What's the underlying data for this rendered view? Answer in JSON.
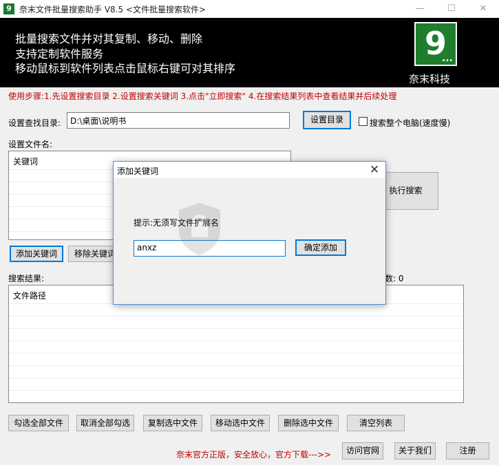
{
  "window": {
    "title": "奈末文件批量搜索助手 V8.5    <文件批量搜索软件>",
    "app_icon_glyph": "9",
    "minimize_glyph": "—",
    "maximize_glyph": "☐",
    "close_glyph": "✕"
  },
  "banner": {
    "lines": [
      "批量搜索文件并对其复制、移动、删除",
      "支持定制软件服务",
      "移动鼠标到软件列表点击鼠标右键可对其排序"
    ],
    "logo_digit": "9",
    "logo_dots": "...",
    "company": "奈末科技"
  },
  "steps_text": "使用步骤:1.先设置搜索目录 2.设置搜索关键词 3.点击\"立即搜索\" 4.在搜索结果列表中查看结果并后续处理",
  "directory": {
    "label": "设置查找目录:",
    "value": "D:\\桌面\\说明书",
    "set_button": "设置目录",
    "whole_pc_label": "搜索整个电脑(速度慢)",
    "whole_pc_checked": false
  },
  "filename": {
    "label": "设置文件名:",
    "list_header": "关键词",
    "add_button": "添加关键词",
    "remove_button": "移除关键词"
  },
  "search_button": "执行搜索",
  "results": {
    "label": "搜索结果:",
    "count_text": "数: 0",
    "list_header": "文件路径"
  },
  "bottom_buttons": [
    "勾选全部文件",
    "取消全部勾选",
    "复制选中文件",
    "移动选中文件",
    "删除选中文件",
    "清空列表"
  ],
  "footer": {
    "note": "奈末官方正版，安全放心，官方下载--->>",
    "visit_button": "访问官网",
    "about_button": "关于我们",
    "register_button": "注册"
  },
  "dialog": {
    "title": "添加关键词",
    "close_glyph": "✕",
    "hint": "提示:无须写文件扩展名",
    "input_value": "anxz",
    "confirm_button": "确定添加"
  },
  "colors": {
    "banner_bg": "#000000",
    "logo_green": "#1f7d2e",
    "accent_red": "#c00000",
    "focus_blue": "#0078d7"
  }
}
